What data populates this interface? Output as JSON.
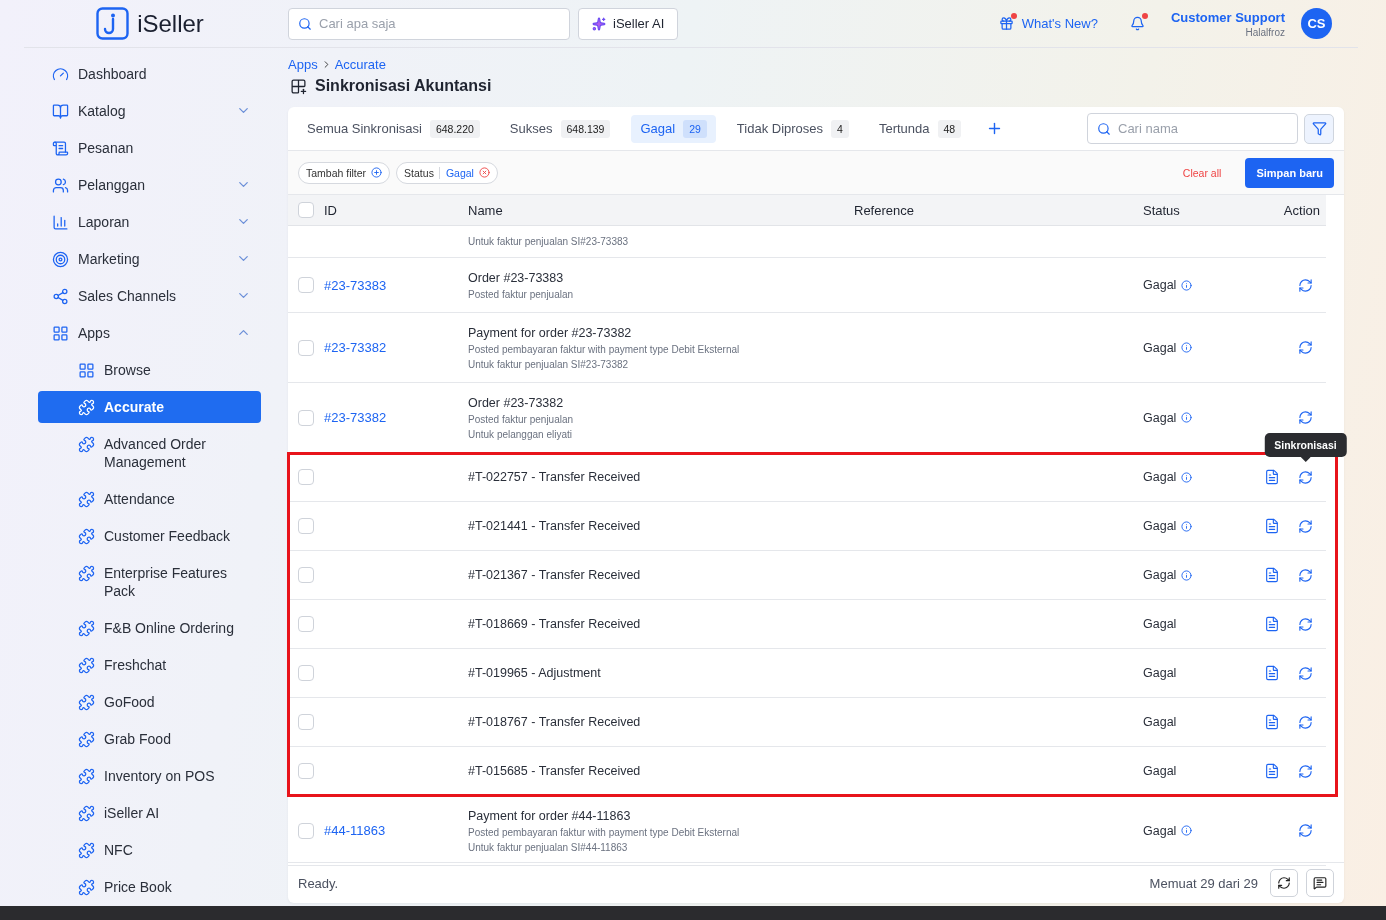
{
  "brand": {
    "name": "iSeller"
  },
  "header": {
    "search": {
      "placeholder": "Cari apa saja"
    },
    "ai_button": "iSeller AI",
    "whats_new": {
      "label": "What's New?",
      "dot": true
    },
    "notifications": {
      "dot": true
    },
    "user": {
      "name": "Customer Support",
      "store": "Halalfroz",
      "initials": "CS"
    }
  },
  "sidebar": {
    "items": [
      {
        "label": "Dashboard",
        "selected": false
      },
      {
        "label": "Katalog",
        "expanded": false,
        "selected": false
      },
      {
        "label": "Pesanan",
        "selected": false
      },
      {
        "label": "Pelanggan",
        "expanded": false,
        "selected": false
      },
      {
        "label": "Laporan",
        "expanded": false,
        "selected": false
      },
      {
        "label": "Marketing",
        "expanded": false,
        "selected": false
      },
      {
        "label": "Sales Channels",
        "expanded": false,
        "selected": false
      },
      {
        "label": "Apps",
        "expanded": true,
        "selected": false,
        "children": [
          {
            "label": "Browse",
            "selected": false
          },
          {
            "label": "Accurate",
            "selected": true
          },
          {
            "label": "Advanced Order Management",
            "selected": false
          },
          {
            "label": "Attendance",
            "selected": false
          },
          {
            "label": "Customer Feedback",
            "selected": false
          },
          {
            "label": "Enterprise Features Pack",
            "selected": false
          },
          {
            "label": "F&B Online Ordering",
            "selected": false
          },
          {
            "label": "Freshchat",
            "selected": false
          },
          {
            "label": "GoFood",
            "selected": false
          },
          {
            "label": "Grab Food",
            "selected": false
          },
          {
            "label": "Inventory on POS",
            "selected": false
          },
          {
            "label": "iSeller AI",
            "selected": false
          },
          {
            "label": "NFC",
            "selected": false
          },
          {
            "label": "Price Book",
            "selected": false
          }
        ]
      }
    ]
  },
  "breadcrumb": [
    "Apps",
    "Accurate"
  ],
  "page_title": "Sinkronisasi Akuntansi",
  "tabs": [
    {
      "label": "Semua Sinkronisasi",
      "count": "648.220",
      "selected": false
    },
    {
      "label": "Sukses",
      "count": "648.139",
      "selected": false
    },
    {
      "label": "Gagal",
      "count": "29",
      "selected": true
    },
    {
      "label": "Tidak Diproses",
      "count": "4",
      "selected": false
    },
    {
      "label": "Tertunda",
      "count": "48",
      "selected": false
    }
  ],
  "name_search": {
    "placeholder": "Cari nama"
  },
  "filters": {
    "add_label": "Tambah filter",
    "chips": [
      {
        "label": "Status",
        "value": "Gagal"
      }
    ],
    "clear": "Clear all",
    "save": "Simpan baru"
  },
  "table": {
    "select_all_checked": false,
    "columns": [
      "ID",
      "Name",
      "Reference",
      "Status",
      "Action"
    ],
    "rows": [
      {
        "lines": [
          "Untuk faktur penjualan SI#23-73383"
        ]
      },
      {
        "id": "#23-73383",
        "checked": false,
        "title": "Order #23-73383",
        "lines": [
          "Posted faktur penjualan"
        ],
        "status": "Gagal",
        "info": true,
        "report": false,
        "highlighted": false
      },
      {
        "id": "#23-73382",
        "checked": false,
        "title": "Payment for order #23-73382",
        "lines": [
          "Posted pembayaran faktur with payment type Debit Eksternal",
          "Untuk faktur penjualan SI#23-73382"
        ],
        "status": "Gagal",
        "info": true,
        "report": false,
        "highlighted": false
      },
      {
        "id": "#23-73382",
        "checked": false,
        "title": "Order #23-73382",
        "lines": [
          "Posted faktur penjualan",
          "Untuk pelanggan eliyati"
        ],
        "status": "Gagal",
        "info": true,
        "report": false,
        "highlighted": false
      },
      {
        "checked": false,
        "title": "#T-022757 - Transfer Received",
        "status": "Gagal",
        "info": true,
        "report": true,
        "highlighted": true,
        "tooltip": "Sinkronisasi"
      },
      {
        "checked": false,
        "title": "#T-021441 - Transfer Received",
        "status": "Gagal",
        "info": true,
        "report": true,
        "highlighted": true
      },
      {
        "checked": false,
        "title": "#T-021367 - Transfer Received",
        "status": "Gagal",
        "info": true,
        "report": true,
        "highlighted": true
      },
      {
        "checked": false,
        "title": "#T-018669 - Transfer Received",
        "status": "Gagal",
        "info": false,
        "report": true,
        "highlighted": true
      },
      {
        "checked": false,
        "title": "#T-019965 - Adjustment",
        "status": "Gagal",
        "info": false,
        "report": true,
        "highlighted": true
      },
      {
        "checked": false,
        "title": "#T-018767 - Transfer Received",
        "status": "Gagal",
        "info": false,
        "report": true,
        "highlighted": true
      },
      {
        "checked": false,
        "title": "#T-015685 - Transfer Received",
        "status": "Gagal",
        "info": false,
        "report": true,
        "highlighted": true
      },
      {
        "id": "#44-11863",
        "checked": false,
        "title": "Payment for order #44-11863",
        "lines": [
          "Posted pembayaran faktur with payment type Debit Eksternal",
          "Untuk faktur penjualan SI#44-11863"
        ],
        "status": "Gagal",
        "info": true,
        "report": false,
        "highlighted": false
      }
    ]
  },
  "footer": {
    "status": "Ready.",
    "count": "Memuat 29 dari 29"
  }
}
